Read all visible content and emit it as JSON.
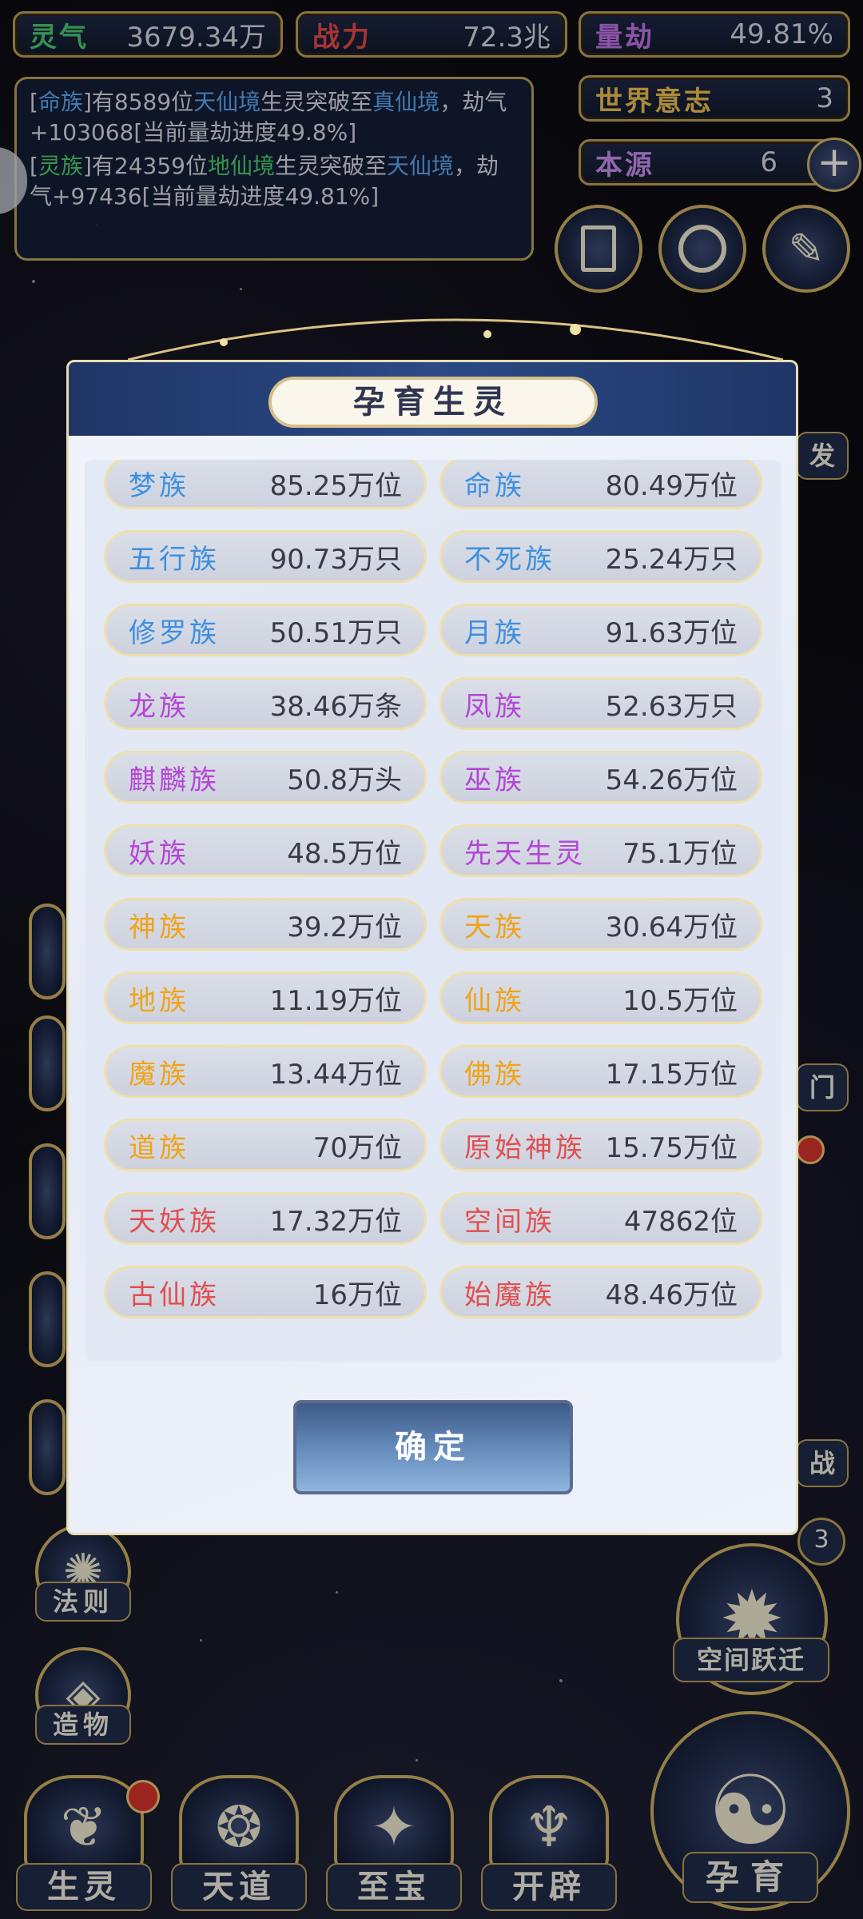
{
  "stats": {
    "lingqi": {
      "label": "灵气",
      "value": "3679.34万"
    },
    "zhanli": {
      "label": "战力",
      "value": "72.3兆"
    },
    "liangjie": {
      "label": "量劫",
      "value": "49.81%"
    },
    "shijie": {
      "label": "世界意志",
      "value": "3"
    },
    "benyuan": {
      "label": "本源",
      "value": "6"
    }
  },
  "log": [
    {
      "pre": "[",
      "tribe": "命族",
      "mid1": "]有8589位",
      "realm": "天仙境",
      "mid2": "生灵突破至",
      "realm2": "真仙境",
      "tail": "，劫气+103068[当前量劫进度49.8%]"
    },
    {
      "pre": "[",
      "tribe": "灵族",
      "mid1": "]有24359位",
      "realm": "地仙境",
      "mid2": "生灵突破至",
      "realm2": "天仙境",
      "tail": "，劫气+97436[当前量劫进度49.81%]"
    }
  ],
  "side_labels": {
    "fa": "发",
    "men": "门",
    "zhan": "战",
    "badge3": "3",
    "fa_ze": "法则",
    "zao_wu": "造物",
    "kong_jian": "空间跃迁"
  },
  "modal": {
    "title": "孕育生灵",
    "confirm": "确定",
    "rows": [
      [
        {
          "name": "梦族",
          "count": "85.25万位",
          "color": "blue"
        },
        {
          "name": "命族",
          "count": "80.49万位",
          "color": "blue"
        }
      ],
      [
        {
          "name": "五行族",
          "count": "90.73万只",
          "color": "blue"
        },
        {
          "name": "不死族",
          "count": "25.24万只",
          "color": "blue"
        }
      ],
      [
        {
          "name": "修罗族",
          "count": "50.51万只",
          "color": "blue"
        },
        {
          "name": "月族",
          "count": "91.63万位",
          "color": "blue"
        }
      ],
      [
        {
          "name": "龙族",
          "count": "38.46万条",
          "color": "purple"
        },
        {
          "name": "凤族",
          "count": "52.63万只",
          "color": "purple"
        }
      ],
      [
        {
          "name": "麒麟族",
          "count": "50.8万头",
          "color": "purple"
        },
        {
          "name": "巫族",
          "count": "54.26万位",
          "color": "purple"
        }
      ],
      [
        {
          "name": "妖族",
          "count": "48.5万位",
          "color": "purple"
        },
        {
          "name": "先天生灵",
          "count": "75.1万位",
          "color": "purple"
        }
      ],
      [
        {
          "name": "神族",
          "count": "39.2万位",
          "color": "orange"
        },
        {
          "name": "天族",
          "count": "30.64万位",
          "color": "orange"
        }
      ],
      [
        {
          "name": "地族",
          "count": "11.19万位",
          "color": "orange"
        },
        {
          "name": "仙族",
          "count": "10.5万位",
          "color": "orange"
        }
      ],
      [
        {
          "name": "魔族",
          "count": "13.44万位",
          "color": "orange"
        },
        {
          "name": "佛族",
          "count": "17.15万位",
          "color": "orange"
        }
      ],
      [
        {
          "name": "道族",
          "count": "70万位",
          "color": "orange"
        },
        {
          "name": "原始神族",
          "count": "15.75万位",
          "color": "red"
        }
      ],
      [
        {
          "name": "天妖族",
          "count": "17.32万位",
          "color": "red"
        },
        {
          "name": "空间族",
          "count": "47862位",
          "color": "red"
        }
      ],
      [
        {
          "name": "古仙族",
          "count": "16万位",
          "color": "red"
        },
        {
          "name": "始魔族",
          "count": "48.46万位",
          "color": "red"
        }
      ]
    ]
  },
  "bottom_nav": [
    "生灵",
    "天道",
    "至宝",
    "开辟"
  ],
  "yunyu": "孕育",
  "colors": {
    "blue": "#3d8fe0",
    "purple": "#b445d6",
    "orange": "#f0a318",
    "red": "#e04f4f",
    "gold": "#b69a56"
  }
}
